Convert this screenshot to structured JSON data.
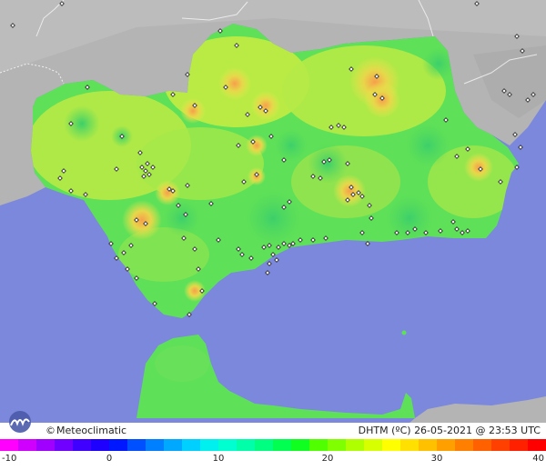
{
  "map": {
    "credit": "Meteoclimatic",
    "credit_symbol": "©",
    "title": "DHTM (ºC) 26-05-2021 @ 23:53 UTC",
    "logo_icon": "meteoclimatic-logo",
    "colors": {
      "sea": "#7b88dc",
      "land_outside": "#b4b4b4",
      "region_base": "#5ee058"
    }
  },
  "legend": {
    "min": -10,
    "max": 40,
    "ticks": [
      {
        "value": -10,
        "label": "-10"
      },
      {
        "value": 0,
        "label": "0"
      },
      {
        "value": 10,
        "label": "10"
      },
      {
        "value": 20,
        "label": "20"
      },
      {
        "value": 30,
        "label": "30"
      },
      {
        "value": 40,
        "label": "40"
      }
    ],
    "colors": [
      "#ff00ff",
      "#d000ff",
      "#a000ff",
      "#7000ff",
      "#4000ff",
      "#1e00ff",
      "#0018ff",
      "#0050ff",
      "#0080ff",
      "#00a8ff",
      "#00d0ff",
      "#00f0f0",
      "#00ffd0",
      "#00ffa8",
      "#00ff80",
      "#00ff50",
      "#10ff20",
      "#50ff00",
      "#80ff00",
      "#b0ff00",
      "#d8ff00",
      "#ffff00",
      "#ffe000",
      "#ffc000",
      "#ffa000",
      "#ff8000",
      "#ff6000",
      "#ff4000",
      "#ff2000",
      "#ff0000"
    ]
  }
}
